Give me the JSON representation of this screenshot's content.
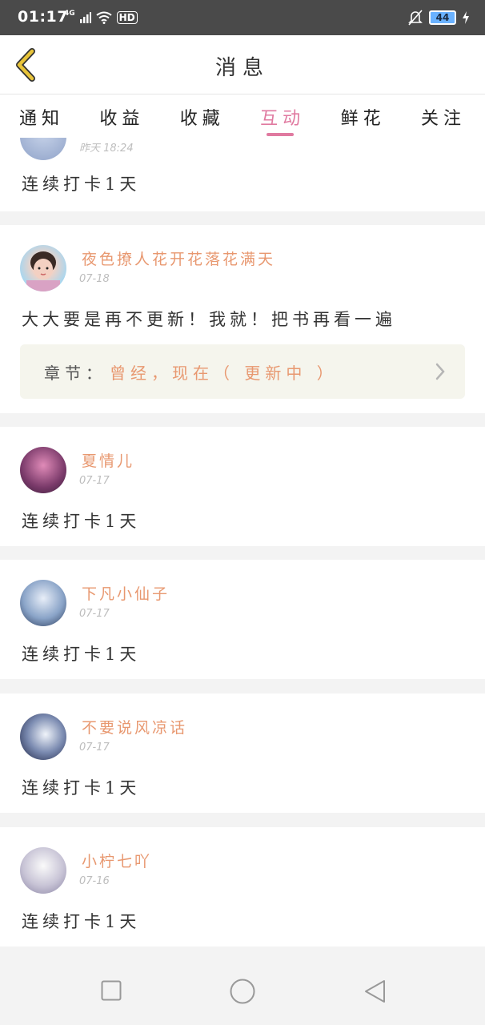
{
  "status_bar": {
    "time": "01:17",
    "network": "4G",
    "hd": "HD",
    "battery": "44"
  },
  "header": {
    "title": "消息"
  },
  "tabs": [
    {
      "label": "通知",
      "active": false
    },
    {
      "label": "收益",
      "active": false
    },
    {
      "label": "收藏",
      "active": false
    },
    {
      "label": "互动",
      "active": true
    },
    {
      "label": "鲜花",
      "active": false
    },
    {
      "label": "关注",
      "active": false
    }
  ],
  "partial_card": {
    "date": "昨天 18:24",
    "message": "连续打卡1天"
  },
  "cards": [
    {
      "username": "夜色撩人花开花落花满天",
      "date": "07-18",
      "message": "大大要是再不更新！我就！把书再看一遍",
      "chapter_label": "章节：",
      "chapter_title": "曾经，现在（ 更新中 ）"
    },
    {
      "username": "夏情儿",
      "date": "07-17",
      "message": "连续打卡1天"
    },
    {
      "username": "下凡小仙子",
      "date": "07-17",
      "message": "连续打卡1天"
    },
    {
      "username": "不要说风凉话",
      "date": "07-17",
      "message": "连续打卡1天"
    },
    {
      "username": "小柠七吖",
      "date": "07-16",
      "message": "连续打卡1天"
    }
  ],
  "colors": {
    "accent_pink": "#e07aa0",
    "username_orange": "#e89870",
    "back_arrow": "#e8c43a"
  }
}
